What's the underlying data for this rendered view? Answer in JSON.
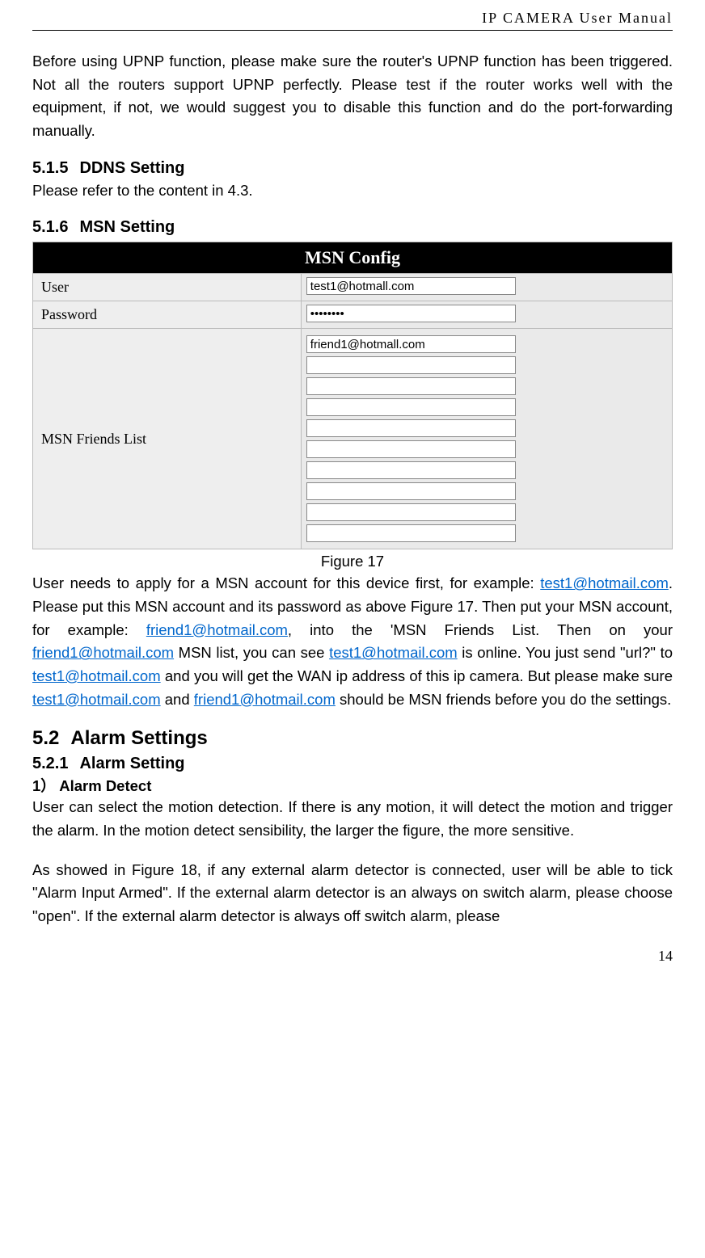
{
  "header": "IP CAMERA User Manual",
  "intro_para": "Before using UPNP function, please make sure the router's UPNP function has been triggered. Not all the routers support UPNP perfectly. Please test if the router works well with the equipment, if not, we would suggest you to disable this function and do the port-forwarding manually.",
  "sec515": {
    "num": "5.1.5",
    "title": "DDNS Setting",
    "text": "Please refer to the content in 4.3."
  },
  "sec516": {
    "num": "5.1.6",
    "title": "MSN Setting"
  },
  "msn": {
    "title": "MSN Config",
    "user_label": "User",
    "user_value": "test1@hotmall.com",
    "password_label": "Password",
    "password_value": "••••••••",
    "friends_label": "MSN Friends List",
    "friends": [
      "friend1@hotmall.com",
      "",
      "",
      "",
      "",
      "",
      "",
      "",
      "",
      ""
    ]
  },
  "figure_caption": "Figure 17",
  "msn_para": {
    "t1": "User needs to apply for a MSN account for this device first, for example: ",
    "link1": "test1@hotmail.com",
    "t2": ". Please put this MSN account and its password as above Figure 17. Then put your MSN account, for example: ",
    "link2": "friend1@hotmail.com",
    "t3": ", into the 'MSN Friends List. Then on your ",
    "link3": "friend1@hotmail.com",
    "t4": " MSN list, you can see ",
    "link4": "test1@hotmail.com",
    "t5": " is online. You just send \"url?\" to ",
    "link5": "test1@hotmail.com",
    "t6": " and you will get the WAN ip address of this ip camera. But please make sure ",
    "link6": "test1@hotmail.com",
    "t7": " and ",
    "link7": "friend1@hotmail.com",
    "t8": " should be MSN friends before you do the settings."
  },
  "sec52": {
    "num": "5.2",
    "title": "Alarm Settings"
  },
  "sec521": {
    "num": "5.2.1",
    "title": "Alarm Setting"
  },
  "alarm_detect_title": "1） Alarm Detect",
  "alarm_detect_text": "User can select the motion detection. If there is any motion, it will detect the motion and trigger the alarm. In the motion detect sensibility, the larger  the figure, the more sensitive.",
  "alarm_fig18_text": "As showed in Figure 18, if any external alarm detector is connected, user will be able to tick \"Alarm Input Armed\". If the external alarm detector is an always on switch alarm, please choose \"open\". If the external alarm detector is always off switch alarm, please",
  "page_num": "14"
}
